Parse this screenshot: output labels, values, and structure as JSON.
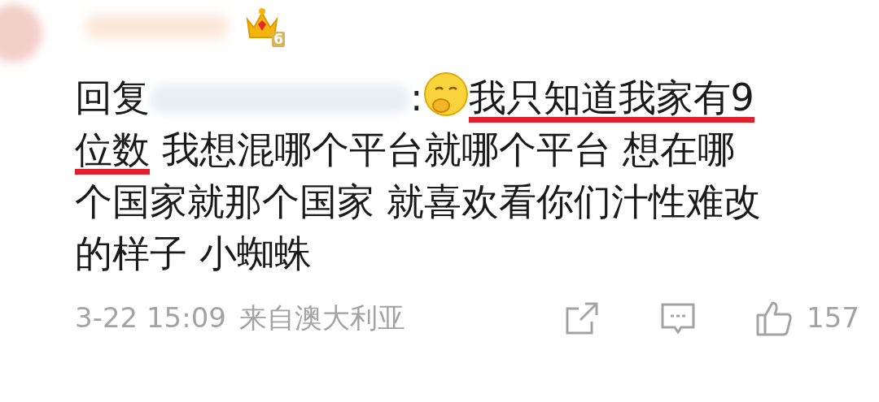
{
  "user": {
    "level_badge": "6"
  },
  "comment": {
    "reply_prefix": "回复",
    "colon": ":",
    "lines": [
      {
        "segments": [
          {
            "text": "我只知道我家有9",
            "underlined": true
          }
        ]
      },
      {
        "segments": [
          {
            "text": "位数",
            "underlined": true
          },
          {
            "text": " 我想混哪个平台就哪个平台 想在哪",
            "underlined": false
          }
        ]
      },
      {
        "segments": [
          {
            "text": "个国家就那个国家 就喜欢看你们汁性难改",
            "underlined": false
          }
        ]
      },
      {
        "segments": [
          {
            "text": "的样子 小蜘蛛",
            "underlined": false
          }
        ]
      }
    ]
  },
  "footer": {
    "time": "3-22 15:09",
    "source": "来自澳大利亚",
    "like_count": "157"
  }
}
